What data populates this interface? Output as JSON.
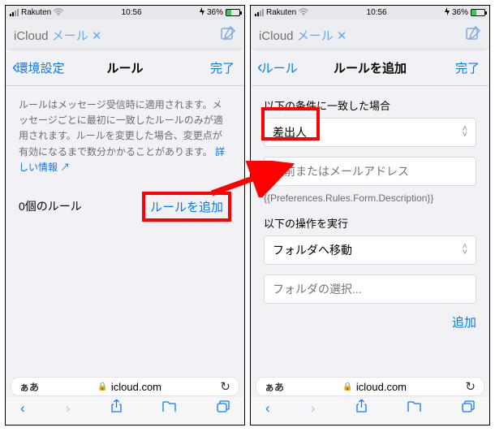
{
  "status": {
    "carrier": "Rakuten",
    "time": "10:56",
    "batteryText": "36%"
  },
  "bg": {
    "title_prefix": "iCloud ",
    "title_mail": "メール",
    "x": "✕"
  },
  "left": {
    "back": "環境設定",
    "title": "ルール",
    "done": "完了",
    "desc": "ルールはメッセージ受信時に適用されます。メッセージごとに最初に一致したルールのみが適用されます。ルールを変更した場合、変更点が有効になるまで数分かかることがあります。",
    "desc_link": "詳しい情報 ↗",
    "count": "0個のルール",
    "add": "ルールを追加"
  },
  "right": {
    "back": "ルール",
    "title": "ルールを追加",
    "done": "完了",
    "cond_label": "以下の条件に一致した場合",
    "cond_value": "差出人",
    "cond_placeholder": "名前またはメールアドレス",
    "desc_raw": "{{Preferences.Rules.Form.Description}}",
    "action_label": "以下の操作を実行",
    "action_value": "フォルダへ移動",
    "action_placeholder": "フォルダの選択...",
    "add_btn": "追加"
  },
  "browser": {
    "aa": "ぁあ",
    "domain": "icloud.com"
  }
}
